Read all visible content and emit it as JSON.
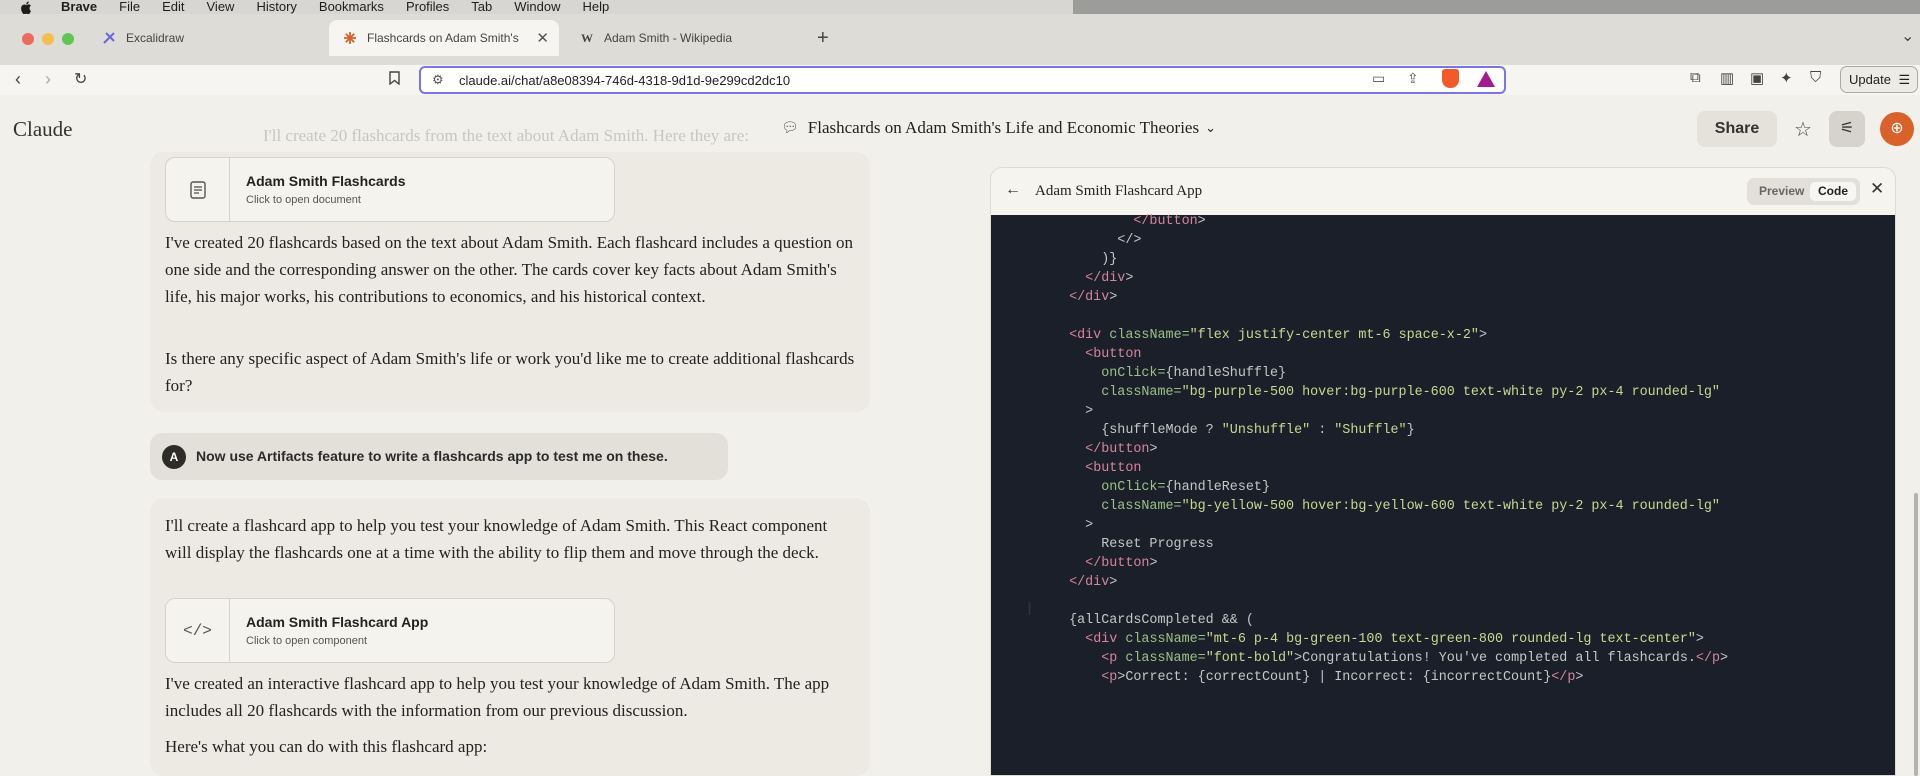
{
  "menubar": {
    "app": "Brave",
    "items": [
      "File",
      "Edit",
      "View",
      "History",
      "Bookmarks",
      "Profiles",
      "Tab",
      "Window",
      "Help"
    ]
  },
  "tabs": [
    {
      "label": "Excalidraw",
      "favicon": "excalidraw-icon"
    },
    {
      "label": "Flashcards on Adam Smith's",
      "favicon": "claude-icon",
      "active": true
    },
    {
      "label": "Adam Smith - Wikipedia",
      "favicon": "W"
    }
  ],
  "address": {
    "url": "claude.ai/chat/a8e08394-746d-4318-9d1d-9e299cd2dc10"
  },
  "toolbar": {
    "update_label": "Update",
    "brave_badge": "2"
  },
  "header": {
    "logo": "Claude",
    "conversation_title": "Flashcards on Adam Smith's Life and Economic Theories",
    "share_label": "Share",
    "accent_color": "#d9622b"
  },
  "chat": {
    "ghost_text": "I'll create 20 flashcards from the text about Adam Smith. Here they are:",
    "doc1": {
      "title": "Adam Smith Flashcards",
      "subtitle": "Click to open document"
    },
    "para1": "I've created 20 flashcards based on the text about Adam Smith. Each flashcard includes a question on one side and the corresponding answer on the other. The cards cover key facts about Adam Smith's life, his major works, his contributions to economics, and his historical context.",
    "para2": "Is there any specific aspect of Adam Smith's life or work you'd like me to create additional flashcards for?",
    "user_avatar": "A",
    "user_message": "Now use Artifacts feature to write a flashcards app to test me on these.",
    "para3": "I'll create a flashcard app to help you test your knowledge of Adam Smith. This React component will display the flashcards one at a time with the ability to flip them and move through the deck.",
    "doc2": {
      "title": "Adam Smith Flashcard App",
      "subtitle": "Click to open component"
    },
    "para4": "I've created an interactive flashcard app to help you test your knowledge of Adam Smith. The app includes all 20 flashcards with the information from our previous discussion.",
    "para5": "Here's what you can do with this flashcard app:"
  },
  "artifact": {
    "title": "Adam Smith Flashcard App",
    "preview_label": "Preview",
    "code_label": "Code",
    "code_lines": [
      "          </button>",
      "        </>",
      "      )}",
      "    </div>",
      "  </div>",
      "",
      "  <div className=\"flex justify-center mt-6 space-x-2\">",
      "    <button",
      "      onClick={handleShuffle}",
      "      className=\"bg-purple-500 hover:bg-purple-600 text-white py-2 px-4 rounded-lg\"",
      "    >",
      "      {shuffleMode ? \"Unshuffle\" : \"Shuffle\"}",
      "    </button>",
      "    <button",
      "      onClick={handleReset}",
      "      className=\"bg-yellow-500 hover:bg-yellow-600 text-white py-2 px-4 rounded-lg\"",
      "    >",
      "      Reset Progress",
      "    </button>",
      "  </div>",
      "",
      "  {allCardsCompleted && (",
      "    <div className=\"mt-6 p-4 bg-green-100 text-green-800 rounded-lg text-center\">",
      "      <p className=\"font-bold\">Congratulations! You've completed all flashcards.</p>",
      "      <p>Correct: {correctCount} | Incorrect: {incorrectCount}</p>"
    ]
  }
}
